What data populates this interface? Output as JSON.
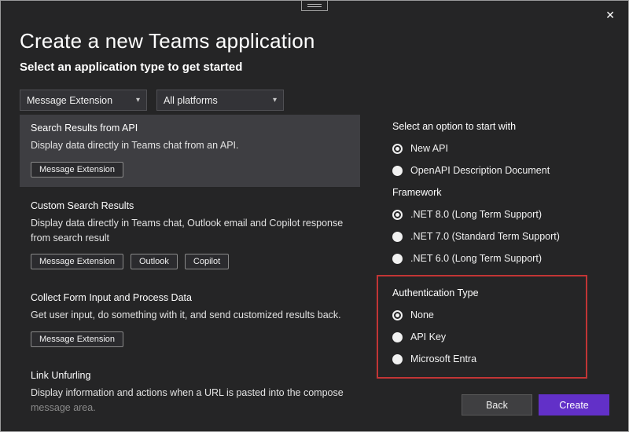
{
  "window": {
    "close_icon": "✕"
  },
  "header": {
    "title": "Create a new Teams application",
    "subtitle": "Select an application type to get started"
  },
  "filters": {
    "type_dropdown": "Message Extension",
    "platform_dropdown": "All platforms",
    "chevron": "▾"
  },
  "templates": [
    {
      "title": "Search Results from API",
      "description": "Display data directly in Teams chat from an API.",
      "tags": [
        "Message Extension"
      ],
      "selected": true
    },
    {
      "title": "Custom Search Results",
      "description": "Display data directly in Teams chat, Outlook email and Copilot response from search result",
      "tags": [
        "Message Extension",
        "Outlook",
        "Copilot"
      ],
      "selected": false
    },
    {
      "title": "Collect Form Input and Process Data",
      "description": "Get user input, do something with it, and send customized results back.",
      "tags": [
        "Message Extension"
      ],
      "selected": false
    },
    {
      "title": "Link Unfurling",
      "description": "Display information and actions when a URL is pasted into the compose ",
      "description_muted": "message area.",
      "tags": [],
      "selected": false
    }
  ],
  "options": {
    "start_with": {
      "label": "Select an option to start with",
      "items": [
        {
          "label": "New API",
          "checked": true
        },
        {
          "label": "OpenAPI Description Document",
          "checked": false
        }
      ]
    },
    "framework": {
      "label": "Framework",
      "items": [
        {
          "label": ".NET 8.0 (Long Term Support)",
          "checked": true
        },
        {
          "label": ".NET 7.0 (Standard Term Support)",
          "checked": false
        },
        {
          "label": ".NET 6.0 (Long Term Support)",
          "checked": false
        }
      ]
    },
    "auth": {
      "label": "Authentication Type",
      "items": [
        {
          "label": "None",
          "checked": true
        },
        {
          "label": "API Key",
          "checked": false
        },
        {
          "label": "Microsoft Entra",
          "checked": false
        }
      ]
    }
  },
  "footer": {
    "back_label": "Back",
    "create_label": "Create"
  },
  "colors": {
    "accent_purple": "#6230c8",
    "highlight_red": "#c23535",
    "selected_item_bg": "#3e3e42"
  }
}
